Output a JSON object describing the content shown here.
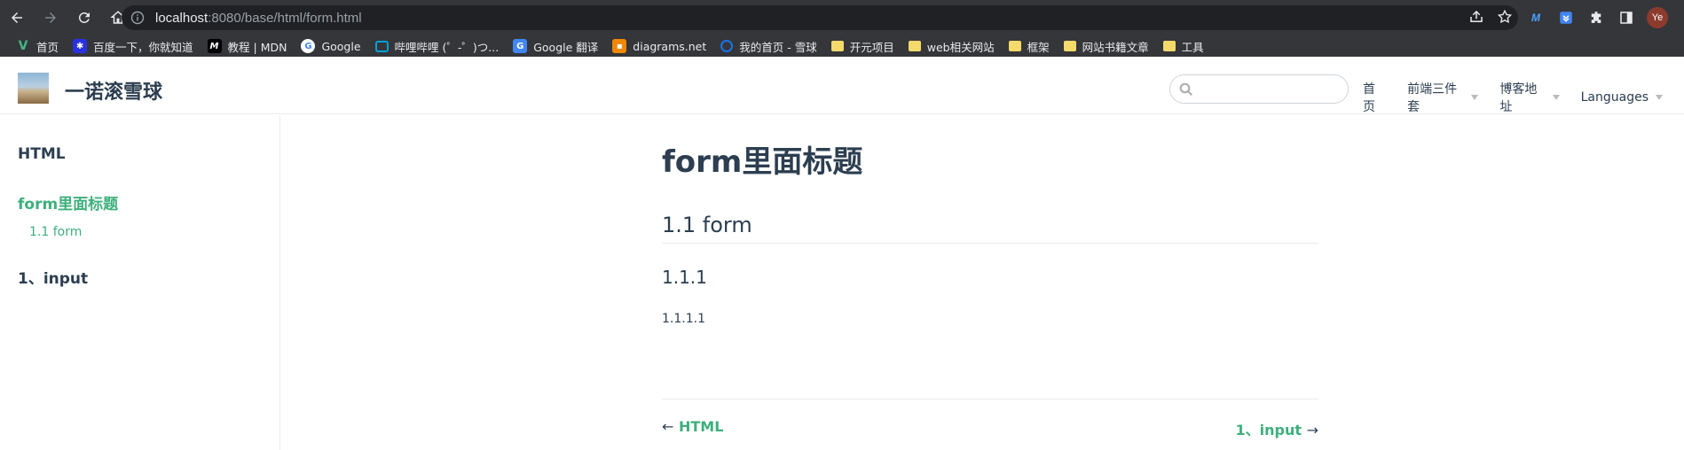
{
  "browser": {
    "url_host": "localhost",
    "url_rest": ":8080/base/html/form.html",
    "avatar_initials": "Ye"
  },
  "bookmarks": [
    {
      "label": "首页",
      "icon": "v-logo-icon",
      "color": "#42b883"
    },
    {
      "label": "百度一下，你就知道",
      "icon": "baidu-icon",
      "color": "#2932e1"
    },
    {
      "label": "教程 | MDN",
      "icon": "mdn-icon",
      "color": "#000000"
    },
    {
      "label": "Google",
      "icon": "google-icon",
      "color": "#ffffff"
    },
    {
      "label": "哔哩哔哩 (゜-゜)つ...",
      "icon": "bilibili-icon",
      "color": "#00a1d6"
    },
    {
      "label": "Google 翻译",
      "icon": "translate-icon",
      "color": "#4285f4"
    },
    {
      "label": "diagrams.net",
      "icon": "diagrams-icon",
      "color": "#f08705"
    },
    {
      "label": "我的首页 - 雪球",
      "icon": "xueqiu-icon",
      "color": "#1a73e8"
    },
    {
      "label": "开元项目",
      "icon": "folder-icon",
      "color": "#f4d96b"
    },
    {
      "label": "web相关网站",
      "icon": "folder-icon",
      "color": "#f4d96b"
    },
    {
      "label": "框架",
      "icon": "folder-icon",
      "color": "#f4d96b"
    },
    {
      "label": "网站书籍文章",
      "icon": "folder-icon",
      "color": "#f4d96b"
    },
    {
      "label": "工具",
      "icon": "folder-icon",
      "color": "#f4d96b"
    }
  ],
  "site": {
    "title": "一诺滚雪球",
    "search_placeholder": "",
    "nav": [
      {
        "label": "首页",
        "dropdown": false
      },
      {
        "label": "前端三件套",
        "dropdown": true
      },
      {
        "label": "博客地址",
        "dropdown": true
      },
      {
        "label": "Languages",
        "dropdown": true
      }
    ]
  },
  "sidebar": {
    "group_title": "HTML",
    "active_title": "form里面标题",
    "active_sub": "1.1 form",
    "next_group": "1、input"
  },
  "content": {
    "h1": "form里面标题",
    "h2": "1.1 form",
    "h3": "1.1.1",
    "h4": "1.1.1.1",
    "prev_arrow": "←",
    "prev_label": "HTML",
    "next_label": "1、input",
    "next_arrow": "→"
  },
  "colors": {
    "accent": "#3eaf7c",
    "text": "#2c3e50",
    "chrome_bg": "#35363a"
  }
}
